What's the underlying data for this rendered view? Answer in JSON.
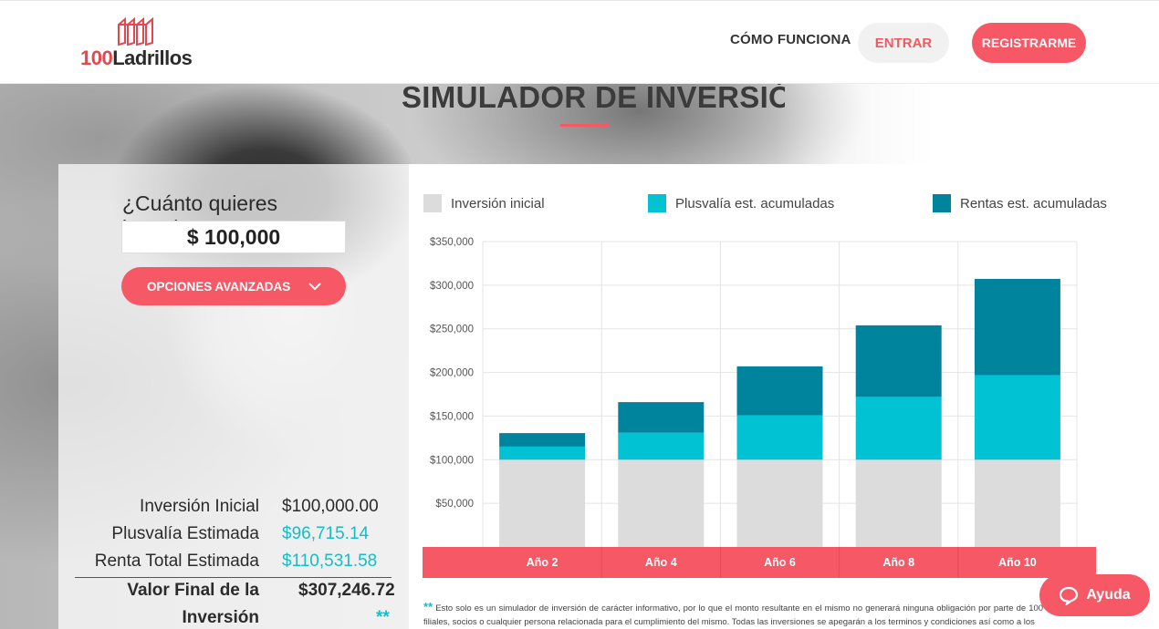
{
  "header": {
    "logo_text_number": "100",
    "logo_text_word": "Ladrillos",
    "nav_como_funciona": "CÓMO FUNCIONA",
    "entrar_label": "ENTRAR",
    "registrarme_label": "REGISTRARME"
  },
  "hero": {
    "title": "SIMULADOR DE INVERSIÓN"
  },
  "calculator": {
    "question": "¿Cuánto quieres invertir?",
    "amount_value": "$ 100,000",
    "advanced_options_label": "OPCIONES AVANZADAS"
  },
  "summary": {
    "rows": [
      {
        "label": "Inversión Inicial",
        "value": "$100,000.00"
      },
      {
        "label": "Plusvalía Estimada",
        "value": "$96,715.14"
      },
      {
        "label": "Renta Total Estimada",
        "value": "$110,531.58"
      }
    ],
    "final_label_line1": "Valor Final de la",
    "final_label_line2": "Inversión",
    "final_value": "$307,246.72",
    "asterisk": "**"
  },
  "chart_data": {
    "type": "bar",
    "stacked": true,
    "categories": [
      "Año 2",
      "Año 4",
      "Año 6",
      "Año 8",
      "Año 10"
    ],
    "series": [
      {
        "name": "Inversión inicial",
        "color": "#dcdcdc",
        "values": [
          100000,
          100000,
          100000,
          100000,
          100000
        ]
      },
      {
        "name": "Plusvalía est. acumuladas",
        "color": "#00c2d2",
        "values": [
          15000,
          31000,
          51000,
          72000,
          96715
        ]
      },
      {
        "name": "Rentas est. acumuladas",
        "color": "#00849e",
        "values": [
          15500,
          35000,
          56000,
          82000,
          110532
        ]
      }
    ],
    "ylim": [
      0,
      350000
    ],
    "yticks": [
      50000,
      100000,
      150000,
      200000,
      250000,
      300000,
      350000
    ],
    "ytick_labels": [
      "$50,000",
      "$100,000",
      "$150,000",
      "$200,000",
      "$250,000",
      "$300,000",
      "$350,000"
    ],
    "grid": true,
    "legend_position": "top",
    "xaxis_band_color": "#f65866"
  },
  "footnote": {
    "star": "**",
    "text": "Esto solo es un simulador de inversión de carácter informativo, por lo que el monto resultante en el mismo no generará ninguna obligación por parte de 100 Ladrillos, sus filiales, socios o cualquier persona relacionada para el cumplimiento del mismo. Todas las inversiones se apegarán a los terminos y condiciones así como a los"
  },
  "help": {
    "label": "Ayuda",
    "icon": "chat-bubble-icon"
  }
}
